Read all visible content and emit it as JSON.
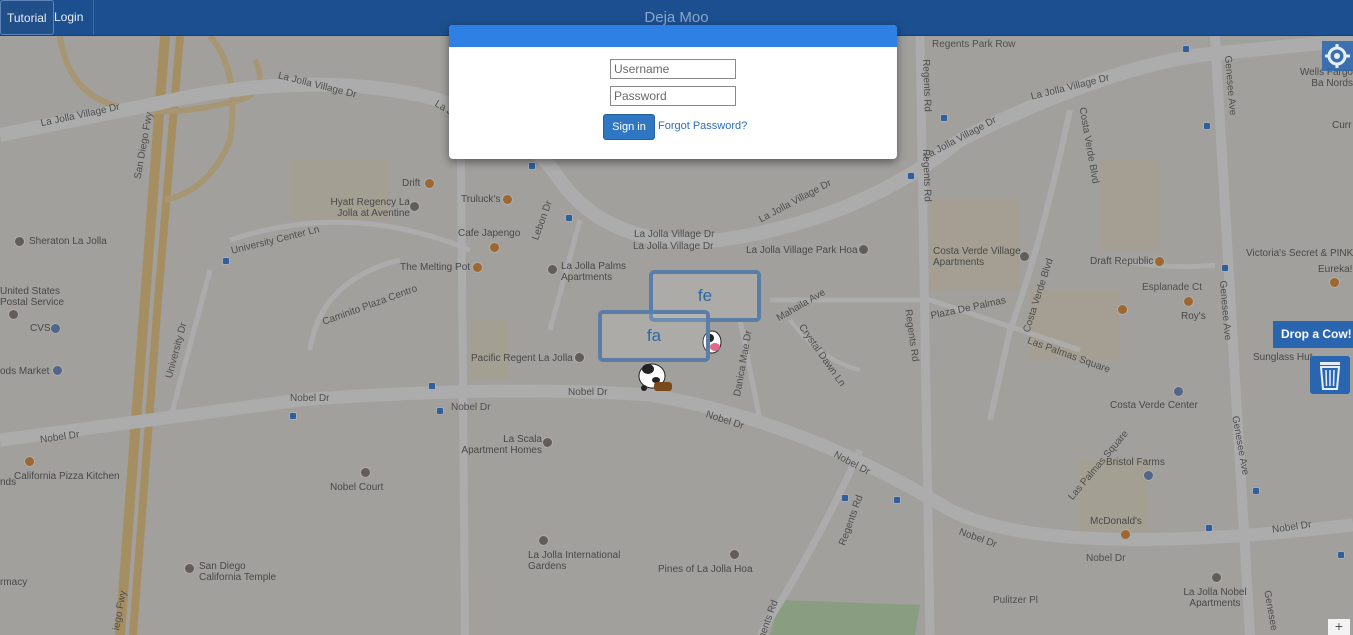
{
  "navbar": {
    "tutorial_label": "Tutorial",
    "login_label": "Login",
    "title": "Deja Moo"
  },
  "login": {
    "username_placeholder": "Username",
    "password_placeholder": "Password",
    "signin_label": "Sign in",
    "forgot_label": "Forgot Password?"
  },
  "cows": [
    {
      "label": "fe"
    },
    {
      "label": "fa"
    }
  ],
  "controls": {
    "drop_cow_label": "Drop a Cow!",
    "zoom_in_label": "+"
  },
  "map": {
    "roads": {
      "la_jolla_village_dr_1": "La Jolla Village Dr",
      "la_jolla_village_dr_2": "La Jolla Village Dr",
      "la_jolla_village_dr_3": "La Jolla Village Dr",
      "la_jolla_village_dr_4": "La Jolla Village Dr",
      "la_jolla_village_dr_5": "La Jolla Village Dr",
      "la_jolla_village_dr_6": "La Jolla Village Dr",
      "la_jolla_village_dr_7": "La Jolla Village Dr",
      "la_jolla_village_dr_8": "La Jolla Village Dr",
      "san_diego_fwy_1": "San Diego Fwy",
      "san_diego_fwy_2": "iego Fwy",
      "nobel_dr_1": "Nobel Dr",
      "nobel_dr_2": "Nobel Dr",
      "nobel_dr_3": "Nobel Dr",
      "nobel_dr_4": "Nobel Dr",
      "nobel_dr_5": "Nobel Dr",
      "nobel_dr_6": "Nobel Dr",
      "nobel_dr_7": "Nobel Dr",
      "nobel_dr_8": "Nobel Dr",
      "nobel_dr_9": "Nobel Dr",
      "university_center_ln": "University Center Ln",
      "caminito_plaza_centro": "Caminito Plaza Centro",
      "university_dr": "University Dr",
      "lebon_dr": "Lebon Dr",
      "regents_rd_1": "Regents Rd",
      "regents_rd_2": "Regents Rd",
      "regents_rd_3": "Regents Rd",
      "regents_rd_4": "Regents Rd",
      "regents_park_row": "Regents Park Row",
      "genesee_ave_1": "Genesee Ave",
      "genesee_ave_2": "Genesee Ave",
      "genesee_ave_3": "Genesee Ave",
      "genesee_ave_4": "Genesee",
      "costa_verde_blvd_1": "Costa Verde Blvd",
      "costa_verde_blvd_2": "Costa Verde Blvd",
      "costa_verde_blvd_3": "Costa Verde Blvd",
      "plaza_de_palmas": "Plaza De Palmas",
      "las_palmas_square_1": "Las Palmas Square",
      "las_palmas_square_2": "Las Palmas Square",
      "esplanade_ct": "Esplanade Ct",
      "mahaila_ave": "Mahaila Ave",
      "danica_mae_dr": "Danica Mae Dr",
      "cristal_dawn_ln": "Crystal Dawn Ln",
      "pulitzer_pl": "Pulitzer Pl",
      "regents_rd_bottom": "Regents Rd"
    },
    "places": {
      "hyatt": "Hyatt Regency La Jolla at Aventine",
      "drift": "Drift",
      "trulucks": "Truluck's",
      "cafe_japengo": "Cafe Japengo",
      "melting_pot": "The Melting Pot",
      "la_jolla_palms": "La Jolla Palms Apartments",
      "sheraton": "Sheraton La Jolla",
      "usps": "United States Postal Service",
      "cvs": "CVS",
      "foods_market": "ods Market",
      "pacific_regent": "Pacific Regent La Jolla",
      "la_scala": "La Scala Apartment Homes",
      "nobel_court": "Nobel Court",
      "cpk": "California Pizza Kitchen",
      "cpk_left": "nds",
      "la_jolla_intl_gardens": "La Jolla International Gardens",
      "pines": "Pines of La Jolla Hoa",
      "temple": "San Diego California Temple",
      "pharmacy": "rmacy",
      "lj_village_park": "La Jolla Village Park Hoa",
      "costa_verde_apts": "Costa Verde Village Apartments",
      "draft_republic": "Draft Republic",
      "roys": "Roy's",
      "costa_verde_center": "Costa Verde Center",
      "bristol_farms": "Bristol Farms",
      "mcdonalds": "McDonald's",
      "lj_nobel_apts": "La Jolla Nobel Apartments",
      "wells_fargo": "Wells Fargo Ba Nords",
      "curry": "Curr",
      "victorias_secret": "Victoria's Secret & PINK",
      "eureka": "Eureka!",
      "sunglass_hut": "Sunglass Hut"
    }
  }
}
